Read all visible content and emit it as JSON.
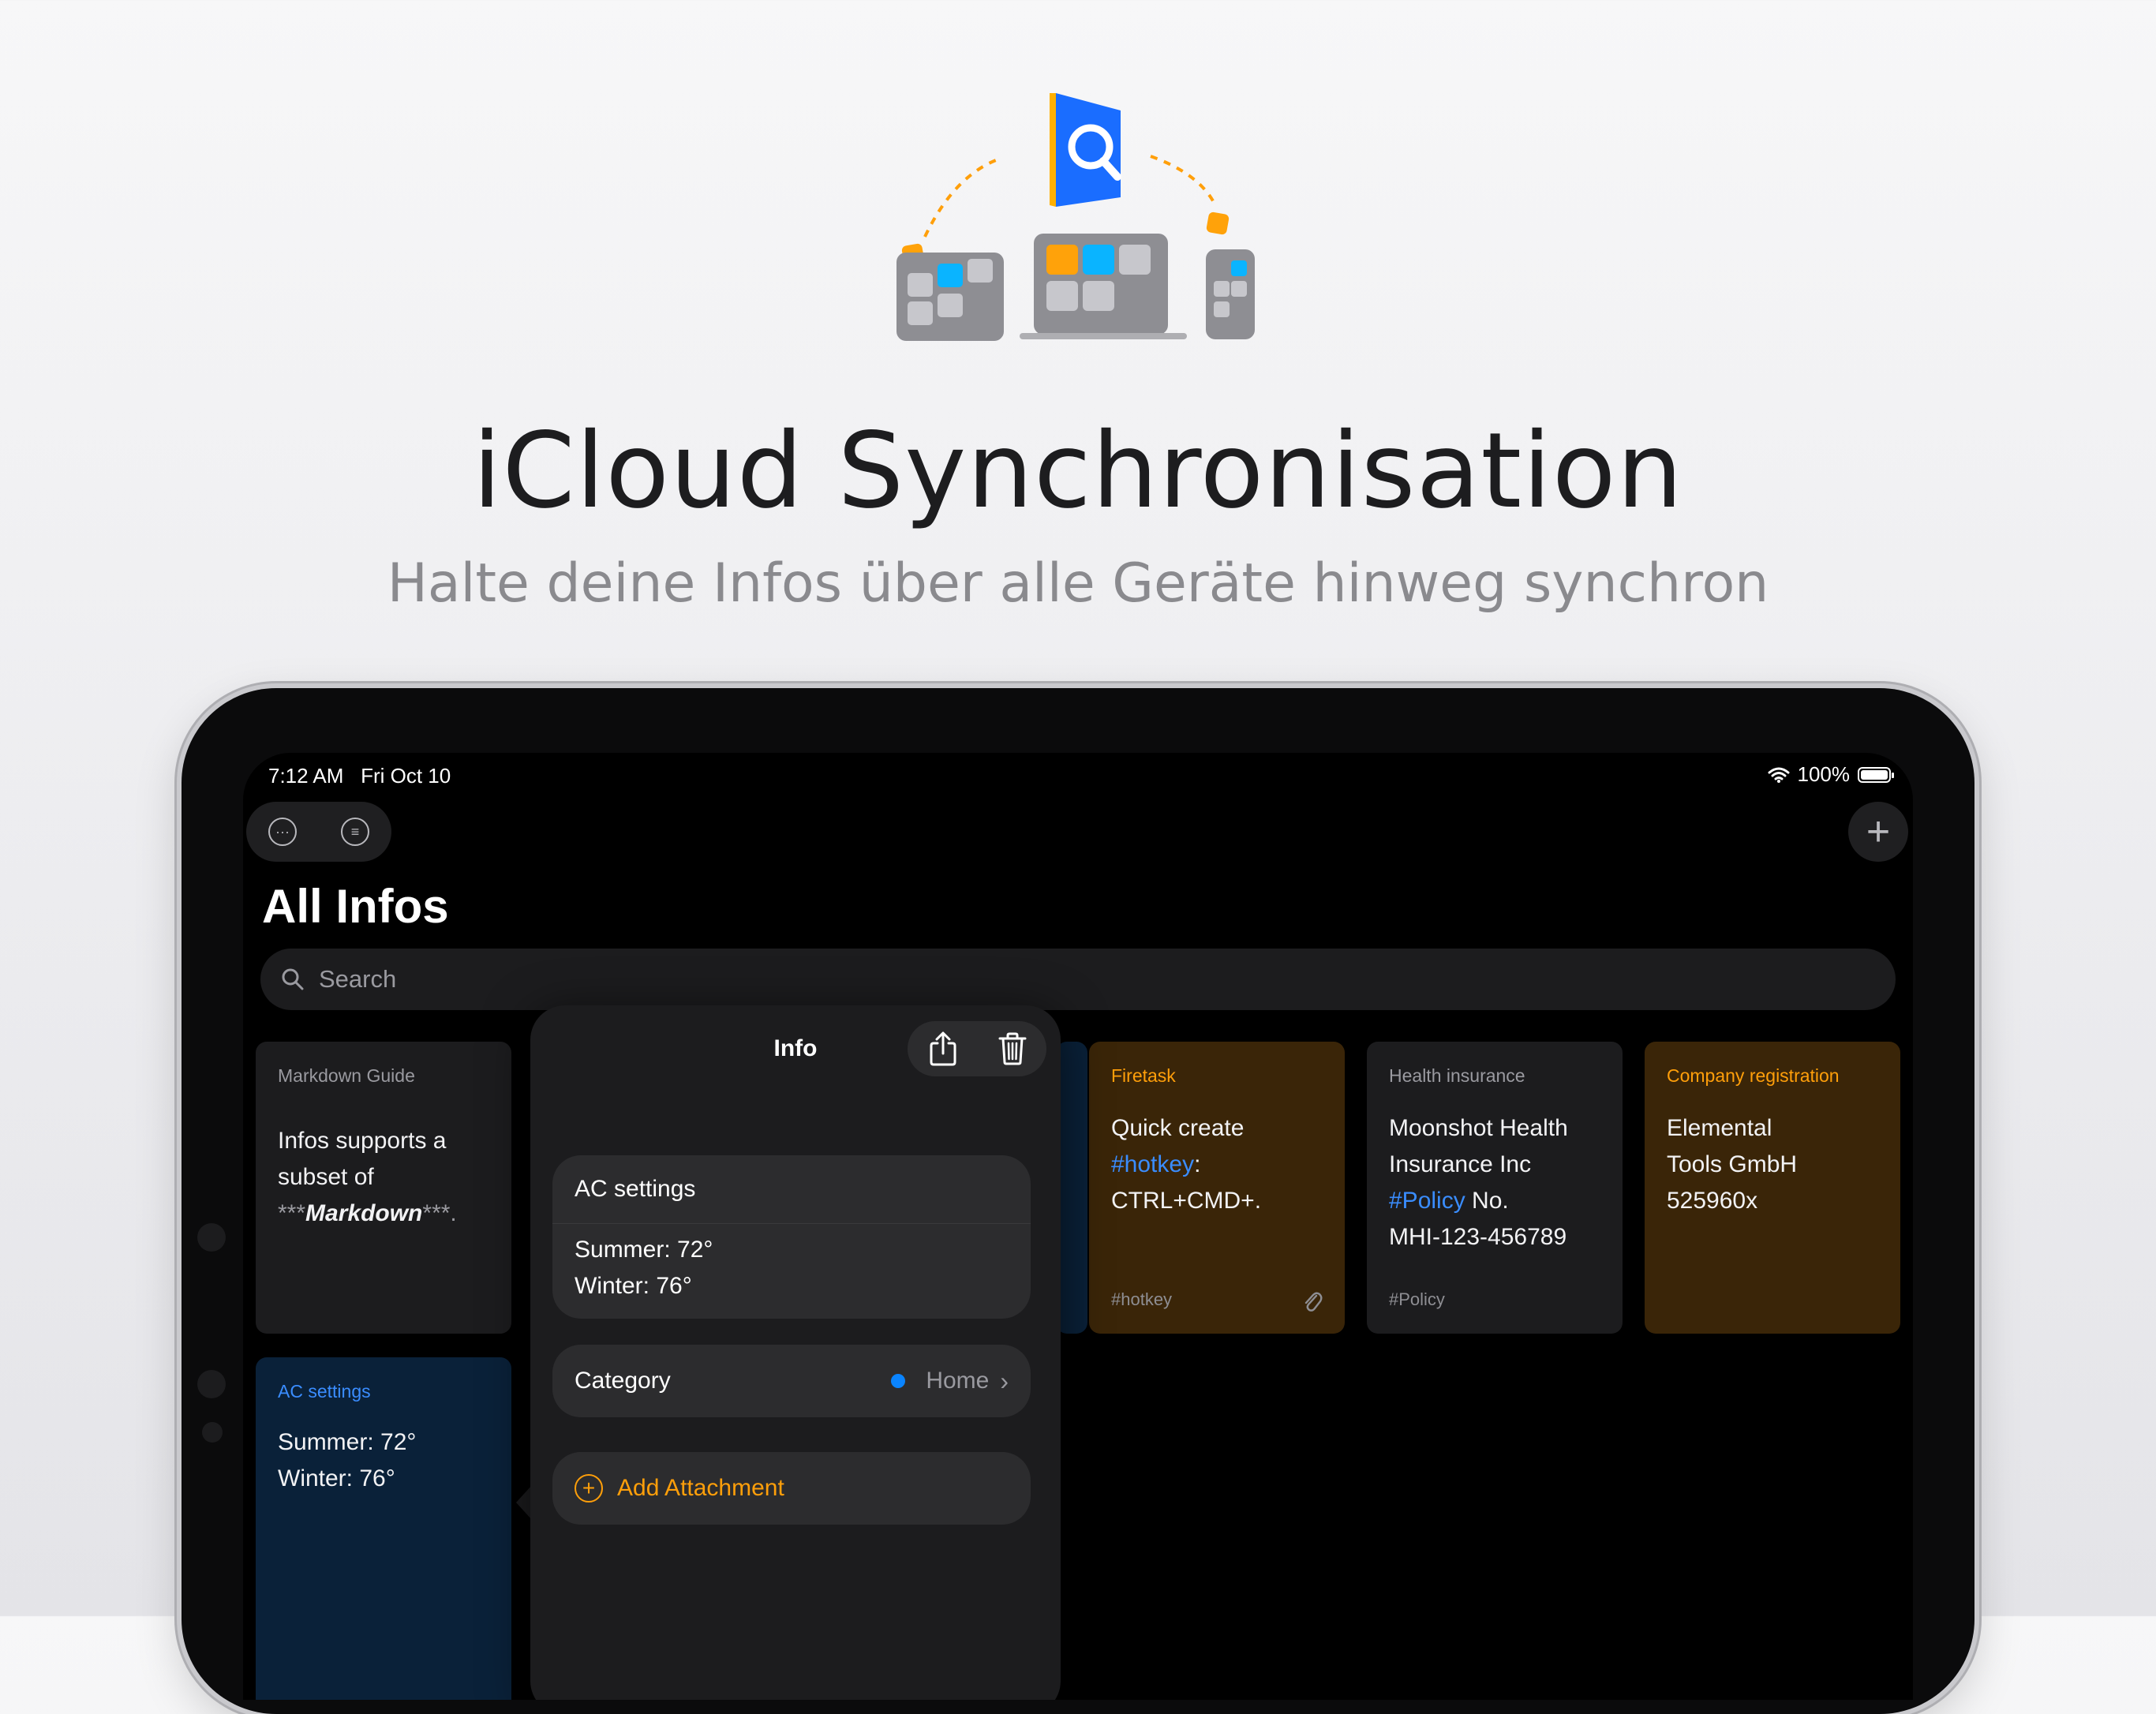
{
  "hero": {
    "title": "iCloud Synchronisation",
    "subtitle": "Halte deine Infos über alle Geräte hinweg synchron",
    "illustration_icon": "sync-devices-icon"
  },
  "status_bar": {
    "time": "7:12 AM   Fri Oct 10",
    "battery": "100%"
  },
  "toolbar": {
    "more_icon": "ellipsis-circle-icon",
    "filter_icon": "filter-lines-circle-icon",
    "add_icon": "plus-icon"
  },
  "page_title": "All Infos",
  "search": {
    "placeholder": "Search"
  },
  "cards": {
    "markdown": {
      "category": "Markdown Guide",
      "body_1": "Infos supports a",
      "body_2": "subset of",
      "body_3_prefix": "***",
      "body_3_bold": "Markdown",
      "body_3_suffix": "***."
    },
    "ac": {
      "category": "AC settings",
      "line_1": "Summer: 72°",
      "line_2": "Winter: 76°"
    },
    "firetask": {
      "category": "Firetask",
      "line_1": "Quick create",
      "line_2_hash": "#hotkey",
      "line_2_rest": ":",
      "line_3": "CTRL+CMD+.",
      "tag": "#hotkey"
    },
    "health": {
      "category": "Health insurance",
      "line_1": "Moonshot Health",
      "line_2": "Insurance Inc",
      "line_3_hash": "#Policy",
      "line_3_rest": " No.",
      "line_4": "MHI-123-456789",
      "tag": "#Policy"
    },
    "company": {
      "category": "Company registration",
      "line_1": "Elemental",
      "line_2": "Tools GmbH",
      "line_3": "525960x"
    }
  },
  "popover": {
    "title": "Info",
    "share_icon": "share-icon",
    "trash_icon": "trash-icon",
    "note_title": "AC settings",
    "note_line_1": "Summer: 72°",
    "note_line_2": "Winter: 76°",
    "category_label": "Category",
    "category_value": "Home",
    "add_attachment": "Add Attachment"
  },
  "colors": {
    "accent_orange": "#ff9f0a",
    "hashtag_blue": "#3a8dff",
    "category_blue": "#0a84ff",
    "card_brown": "#3a2508",
    "card_navy": "#0a2139"
  }
}
